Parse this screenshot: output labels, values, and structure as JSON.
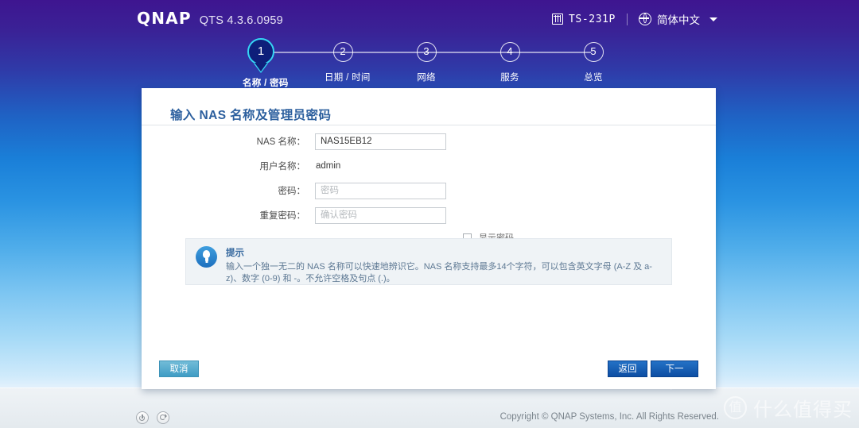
{
  "header": {
    "brand": "QNAP",
    "version": "QTS 4.3.6.0959",
    "device_name": "TS-231P",
    "device_icon": "nas-device-icon",
    "language": "简体中文",
    "language_icon": "globe-icon",
    "caret_icon": "chevron-down-icon",
    "gradient_top": "#3e1590",
    "gradient_bottom": "#e3f1fc"
  },
  "stepper": {
    "current": 1,
    "steps": [
      {
        "number": "1",
        "label": "名称 / 密码"
      },
      {
        "number": "2",
        "label": "日期 / 时间"
      },
      {
        "number": "3",
        "label": "网络"
      },
      {
        "number": "4",
        "label": "服务"
      },
      {
        "number": "5",
        "label": "总览"
      }
    ],
    "active_fill": "#0e1f7a",
    "active_border": "#35d6f5"
  },
  "card": {
    "title": "输入 NAS 名称及管理员密码",
    "title_color": "#2c5f9e",
    "form": {
      "nas_name_label": "NAS 名称：",
      "nas_name_value": "NAS15EB12",
      "username_label": "用户名称：",
      "username_value": "admin",
      "password_label": "密码：",
      "password_placeholder": "密码",
      "password_value": "",
      "confirm_label": "重复密码：",
      "confirm_placeholder": "确认密码",
      "confirm_value": "",
      "show_password_label": "显示密码",
      "show_password_checked": false
    },
    "tip": {
      "icon": "lightbulb-icon",
      "title": "提示",
      "text": "输入一个独一无二的 NAS 名称可以快速地辨识它。NAS 名称支持最多14个字符，可以包含英文字母 (A-Z 及 a-z)、数字 (0-9) 和 -。不允许空格及句点 (.)。"
    },
    "buttons": {
      "cancel": "取消",
      "back": "返回",
      "next": "下一步"
    }
  },
  "footer": {
    "power_icon": "power-icon",
    "restart_icon": "restart-icon",
    "copyright": "Copyright © QNAP Systems, Inc. All Rights Reserved."
  },
  "watermark": {
    "logo": "值",
    "text": "什么值得买"
  }
}
